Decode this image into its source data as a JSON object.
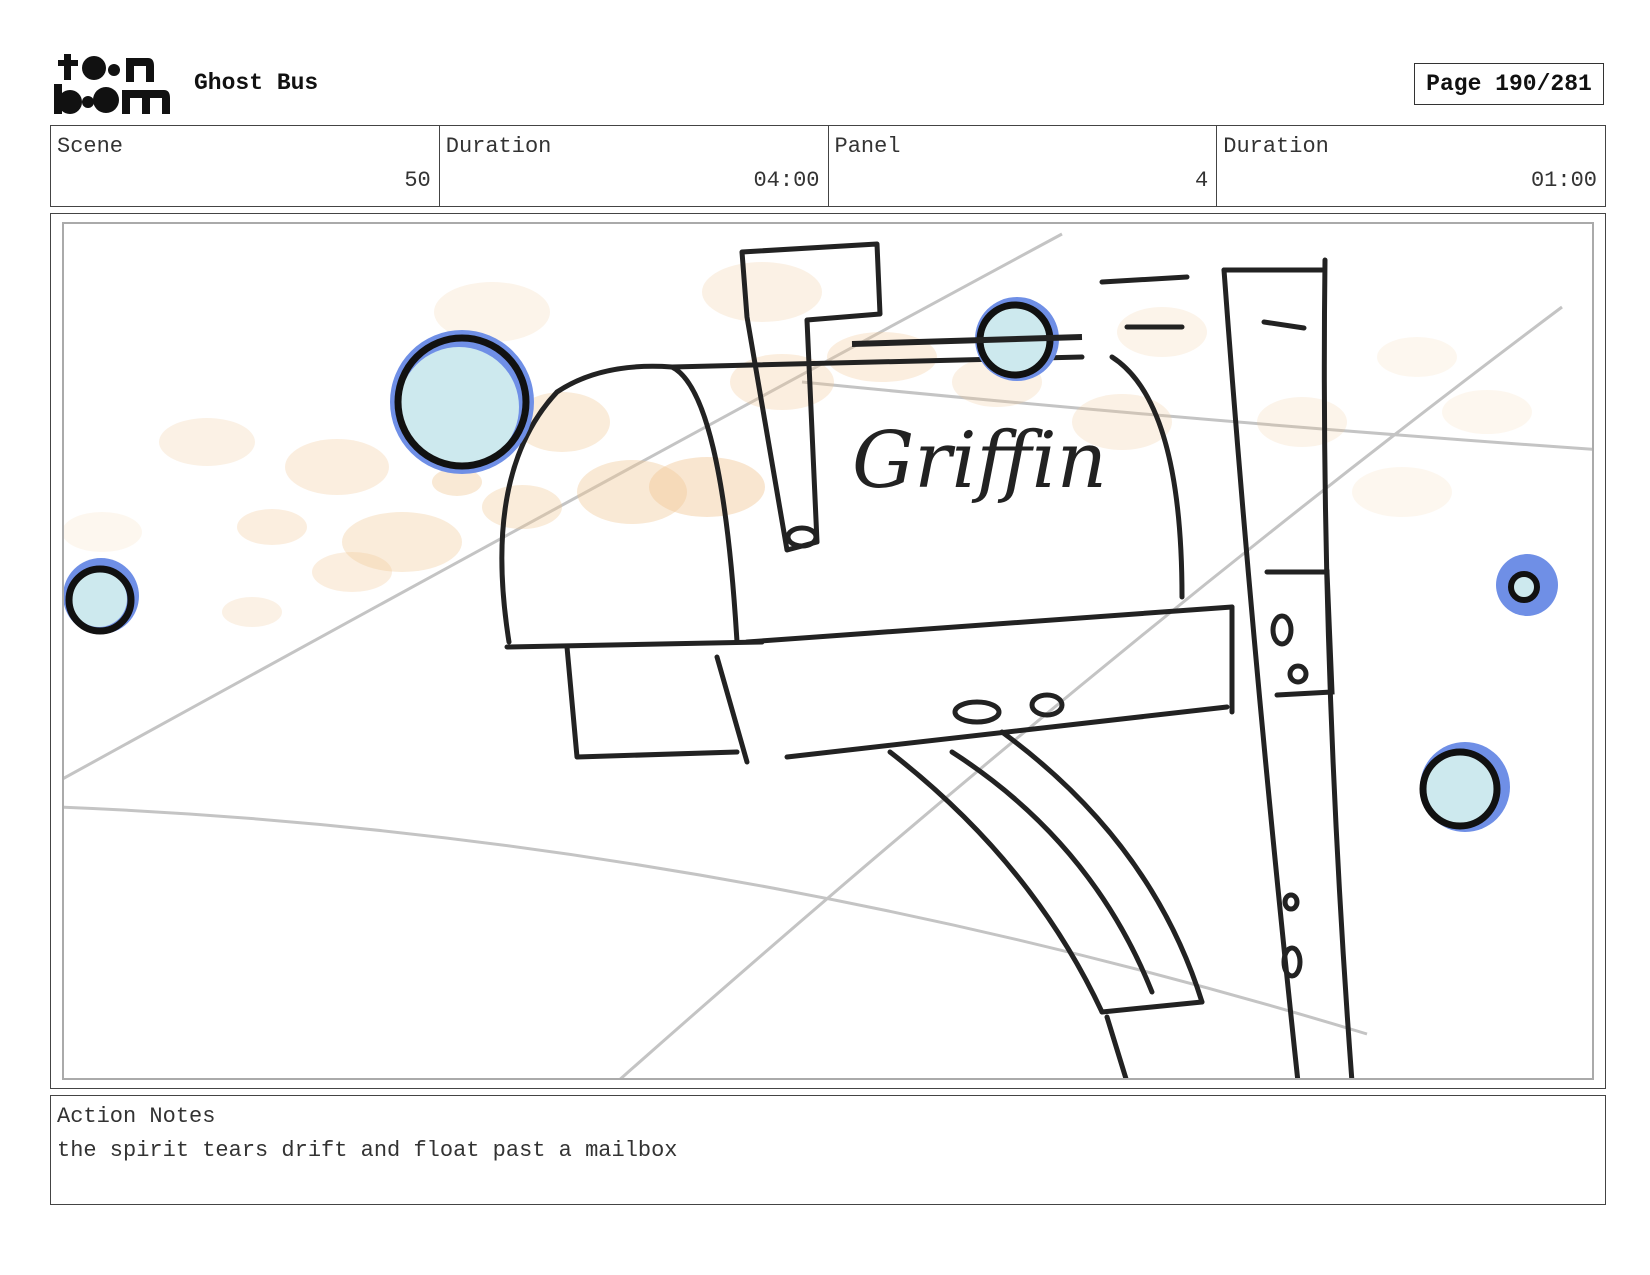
{
  "header": {
    "logo_text": "toon boom",
    "project_title": "Ghost Bus",
    "page_label": "Page 190/281"
  },
  "info": {
    "scene_label": "Scene",
    "scene_value": "50",
    "scene_duration_label": "Duration",
    "scene_duration_value": "04:00",
    "panel_label": "Panel",
    "panel_value": "4",
    "panel_duration_label": "Duration",
    "panel_duration_value": "01:00"
  },
  "panel_image": {
    "mailbox_text": "Griffin",
    "colors": {
      "tear_outer": "#6f8fe6",
      "tear_inner": "#cde9ee",
      "dust": "#f1c896",
      "ink": "#222222",
      "guide": "#c4c4c4"
    }
  },
  "notes": {
    "label": "Action Notes",
    "text": "the spirit tears drift and float past a mailbox"
  }
}
